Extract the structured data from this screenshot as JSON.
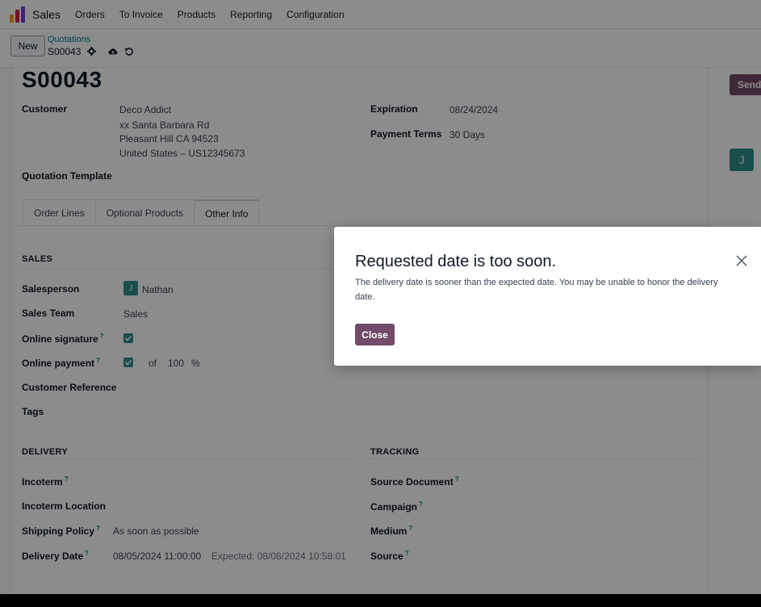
{
  "navbar": {
    "app_name": "Sales",
    "menu": [
      "Orders",
      "To Invoice",
      "Products",
      "Reporting",
      "Configuration"
    ]
  },
  "control": {
    "new_label": "New",
    "breadcrumb": "Quotations",
    "record": "S00043"
  },
  "chatter": {
    "send_label": "Send",
    "avatar_letter": "J"
  },
  "form": {
    "title": "S00043",
    "customer_label": "Customer",
    "customer_lines": [
      "Deco Addict",
      "xx Santa Barbara Rd",
      "Pleasant Hill CA 94523",
      "United States – US12345673"
    ],
    "expiration_label": "Expiration",
    "expiration_value": "08/24/2024",
    "payment_terms_label": "Payment Terms",
    "payment_terms_value": "30 Days",
    "quotation_template_label": "Quotation Template",
    "tabs": [
      "Order Lines",
      "Optional Products",
      "Other Info"
    ],
    "sales": {
      "title": "SALES",
      "salesperson_label": "Salesperson",
      "salesperson_initial": "J",
      "salesperson_value": "Nathan",
      "sales_team_label": "Sales Team",
      "sales_team_value": "Sales",
      "online_signature_label": "Online signature",
      "online_payment_label": "Online payment",
      "of_label": "of",
      "payment_percent": "100",
      "percent_sign": "%",
      "customer_reference_label": "Customer Reference",
      "tags_label": "Tags"
    },
    "delivery": {
      "title": "DELIVERY",
      "incoterm_label": "Incoterm",
      "incoterm_location_label": "Incoterm Location",
      "shipping_policy_label": "Shipping Policy",
      "shipping_policy_value": "As soon as possible",
      "delivery_date_label": "Delivery Date",
      "delivery_date_value": "08/05/2024 11:00:00",
      "expected_value": "Expected: 08/08/2024 10:58:01"
    },
    "tracking": {
      "title": "TRACKING",
      "source_document_label": "Source Document",
      "campaign_label": "Campaign",
      "medium_label": "Medium",
      "source_label": "Source"
    },
    "help_mark": "?"
  },
  "modal": {
    "title": "Requested date is too soon.",
    "body": "The delivery date is sooner than the expected date. You may be unable to honor the delivery date.",
    "close_label": "Close"
  }
}
